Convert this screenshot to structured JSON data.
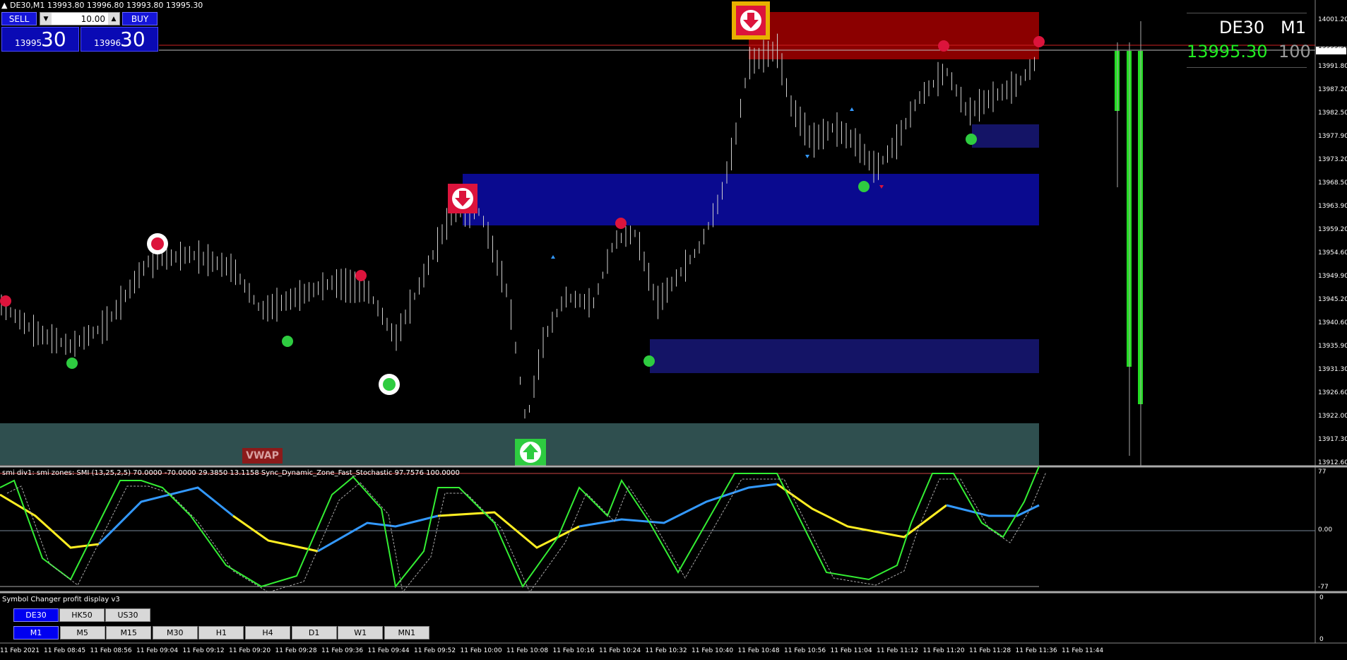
{
  "header": {
    "symbol_tf": "DE30,M1",
    "ohlc": "13993.80 13996.80 13993.80 13995.30"
  },
  "trade_panel": {
    "sell_label": "SELL",
    "buy_label": "BUY",
    "volume": "10.00",
    "sell_small": "13995",
    "sell_big": "30",
    "buy_small": "13996",
    "buy_big": "30"
  },
  "info_box": {
    "symbol": "DE30",
    "timeframe": "M1",
    "price": "13995.30",
    "percent": "100"
  },
  "vwap_label": "VWAP",
  "price_axis": {
    "labels": [
      "14001.20",
      "13995.30",
      "13991.80",
      "13987.20",
      "13982.50",
      "13977.90",
      "13973.20",
      "13968.50",
      "13963.90",
      "13959.20",
      "13954.60",
      "13949.90",
      "13945.20",
      "13940.60",
      "13935.90",
      "13931.30",
      "13926.60",
      "13922.00",
      "13917.30",
      "13912.60"
    ]
  },
  "sub_window": {
    "title": "smi div1: smi zones: SMI (13,25,2,5) 70.0000 -70.0000 29.3850 13.1158  Sync_Dynamic_Zone_Fast_Stochastic 97.7576 100.0000",
    "axis_labels": [
      "77",
      "0.00",
      "-77"
    ]
  },
  "symbol_changer": {
    "title": "Symbol Changer profit display v3",
    "symbols": [
      "DE30",
      "HK50",
      "US30"
    ],
    "active_symbol": "DE30",
    "timeframes": [
      "M1",
      "M5",
      "M15",
      "M30",
      "H1",
      "H4",
      "D1",
      "W1",
      "MN1"
    ],
    "active_tf": "M1",
    "axis_labels": [
      "0",
      "0"
    ]
  },
  "time_axis": {
    "labels": [
      "11 Feb 2021",
      "11 Feb 08:45",
      "11 Feb 08:56",
      "11 Feb 09:04",
      "11 Feb 09:12",
      "11 Feb 09:20",
      "11 Feb 09:28",
      "11 Feb 09:36",
      "11 Feb 09:44",
      "11 Feb 09:52",
      "11 Feb 10:00",
      "11 Feb 10:08",
      "11 Feb 10:16",
      "11 Feb 10:24",
      "11 Feb 10:32",
      "11 Feb 10:40",
      "11 Feb 10:48",
      "11 Feb 10:56",
      "11 Feb 11:04",
      "11 Feb 11:12",
      "11 Feb 11:20",
      "11 Feb 11:28",
      "11 Feb 11:36",
      "11 Feb 11:44"
    ]
  },
  "colors": {
    "supply_zone": "#8b0000",
    "demand_zone": "#0a0a8f",
    "demand_zone_light": "#141466",
    "vwap_band": "#2f4f4f",
    "buy_dot": "#2ecc40",
    "sell_dot": "#dc143c",
    "smi_fast_up": "#33ee33",
    "smi_fast_down": "#ee2222",
    "smi_slow_up": "#3399ff",
    "smi_slow_down": "#ffee22",
    "volume_bar": "#22dd22"
  }
}
